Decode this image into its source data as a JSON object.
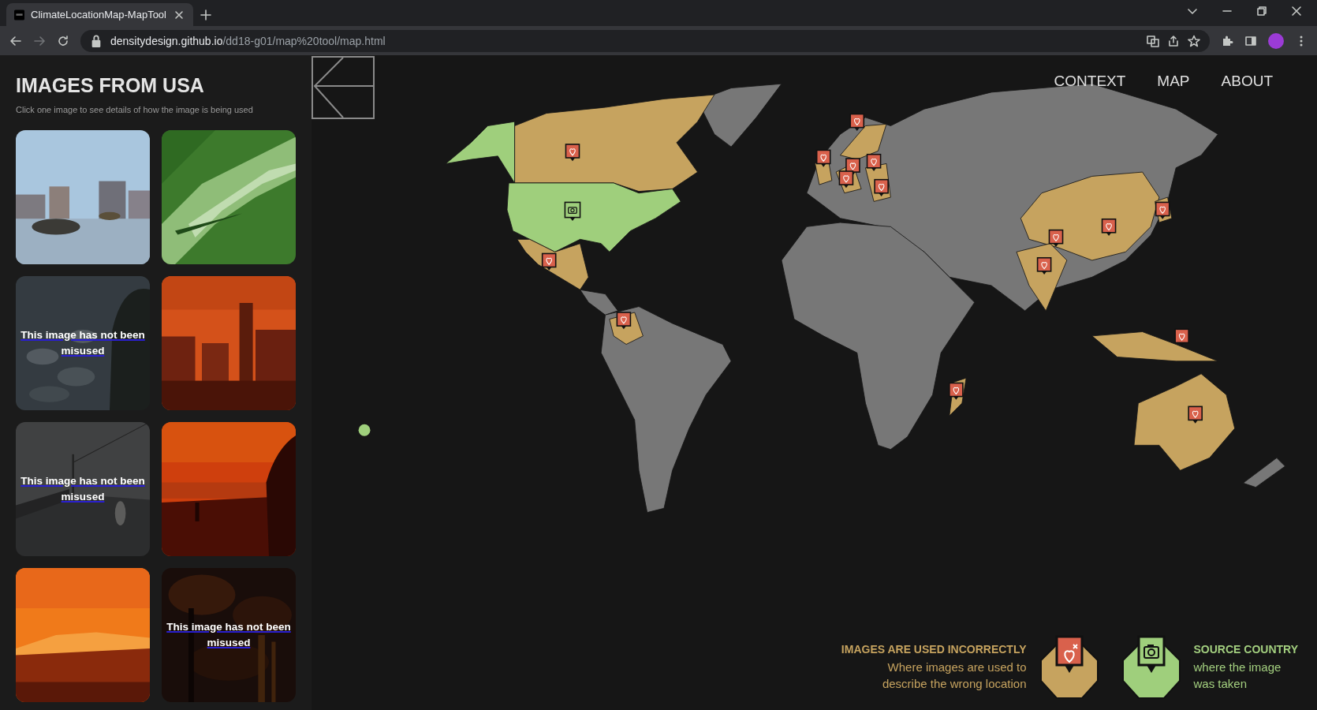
{
  "browser": {
    "tab_title": "ClimateLocationMap-MapTool",
    "url_host": "densitydesign.github.io",
    "url_path": "/dd18-g01/map%20tool/map.html",
    "forward_disabled": true
  },
  "sidebar": {
    "title": "IMAGES FROM USA",
    "subtitle": "Click one image to see details of how the image is being used",
    "images": [
      {
        "kind": "picture"
      },
      {
        "kind": "picture"
      },
      {
        "kind": "picture",
        "caption": "This image has not been misused"
      },
      {
        "kind": "picture"
      },
      {
        "kind": "picture",
        "caption": "This image has not been misused"
      },
      {
        "kind": "picture"
      },
      {
        "kind": "picture"
      },
      {
        "kind": "picture",
        "caption": "This image has not been misused"
      }
    ]
  },
  "nav": [
    {
      "label": "CONTEXT"
    },
    {
      "label": "MAP"
    },
    {
      "label": "ABOUT"
    }
  ],
  "legend": [
    {
      "kind": "misused",
      "title": "IMAGES ARE USED INCORRECTLY",
      "description": "Where images are used to describe the wrong location"
    },
    {
      "kind": "source",
      "title": "SOURCE COUNTRY",
      "description": "where the image was taken"
    }
  ]
}
